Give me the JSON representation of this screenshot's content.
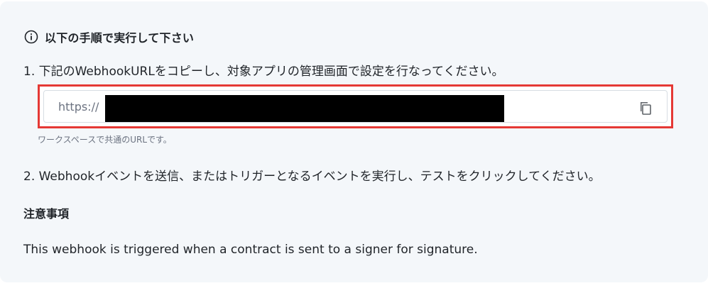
{
  "instructions": {
    "header": {
      "icon": "info-circle-icon",
      "title": "以下の手順で実行して下さい"
    },
    "step1": "1. 下記のWebhookURLをコピーし、対象アプリの管理画面で設定を行なってください。",
    "webhook": {
      "url_prefix": "https://",
      "redacted": true,
      "copy_icon": "copy-icon"
    },
    "helper": "ワークスペースで共通のURLです。",
    "step2": "2. Webhookイベントを送信、またはトリガーとなるイベントを実行し、テストをクリックしてください。"
  },
  "notes": {
    "title": "注意事項",
    "description": "This webhook is triggered when a contract is sent to a signer for signature."
  },
  "colors": {
    "panel_bg": "#f4f7fa",
    "highlight_border": "#e53935",
    "muted_text": "#6b7280"
  }
}
